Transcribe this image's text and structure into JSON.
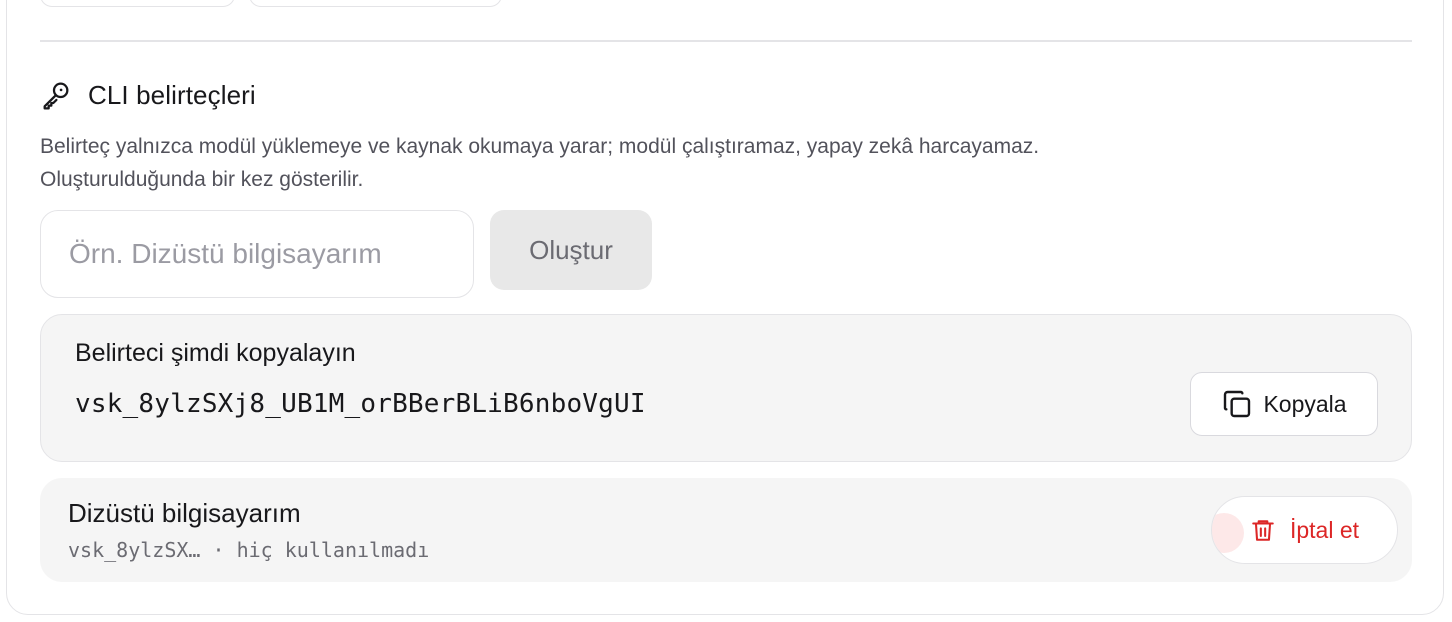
{
  "section": {
    "title": "CLI belirteçleri",
    "description_line1": "Belirteç yalnızca modül yüklemeye ve kaynak okumaya yarar; modül çalıştıramaz, yapay zekâ harcayamaz.",
    "description_line2": "Oluşturulduğunda bir kez gösterilir.",
    "icon": "key-icon"
  },
  "create_form": {
    "name_placeholder": "Örn. Dizüstü bilgisayarım",
    "name_value": "",
    "create_label": "Oluştur"
  },
  "new_token": {
    "heading": "Belirteci şimdi kopyalayın",
    "value": "vsk_8ylzSXj8_UB1M_orBBerBLiB6nboVgUI",
    "copy_label": "Kopyala",
    "copy_icon": "copy-icon"
  },
  "tokens": [
    {
      "name": "Dizüstü bilgisayarım",
      "prefix": "vsk_8ylzSX…",
      "separator": "·",
      "usage": "hiç kullanılmadı",
      "revoke_label": "İptal et",
      "revoke_icon": "trash-icon"
    }
  ],
  "colors": {
    "danger": "#dc2626",
    "muted_text": "#52525b",
    "panel_bg": "#f5f5f5",
    "border": "#e4e4e7"
  }
}
